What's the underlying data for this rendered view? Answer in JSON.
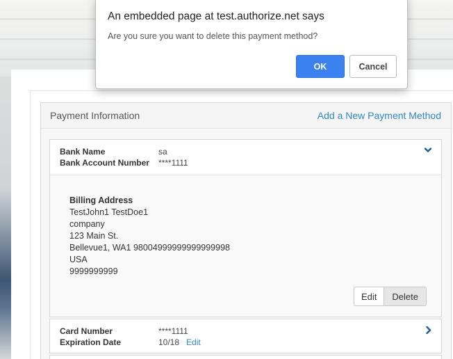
{
  "dialog": {
    "title": "An embedded page at test.authorize.net says",
    "message": "Are you sure you want to delete this payment method?",
    "ok_label": "OK",
    "cancel_label": "Cancel"
  },
  "payment": {
    "title": "Payment Information",
    "add_link": "Add a New Payment Method"
  },
  "bank": {
    "bank_name_label": "Bank Name",
    "bank_name_value": "sa",
    "account_label": "Bank Account Number",
    "account_value": "****1111",
    "billing": {
      "heading": "Billing Address",
      "lines": [
        "TestJohn1 TestDoe1",
        "company",
        "123 Main St.",
        "Bellevue1, WA1 98004999999999999998",
        "USA",
        "9999999999"
      ]
    },
    "edit_label": "Edit",
    "delete_label": "Delete",
    "expand_icon": "chevron-down-icon"
  },
  "card": {
    "number_label": "Card Number",
    "number_value": "****1111",
    "expiration_label": "Expiration Date",
    "expiration_value": "10/18",
    "edit_label": "Edit",
    "expand_icon": "chevron-right-icon"
  },
  "colors": {
    "link": "#2f86c8",
    "ok_button": "#3b82f0",
    "chevron": "#1f5e97"
  }
}
